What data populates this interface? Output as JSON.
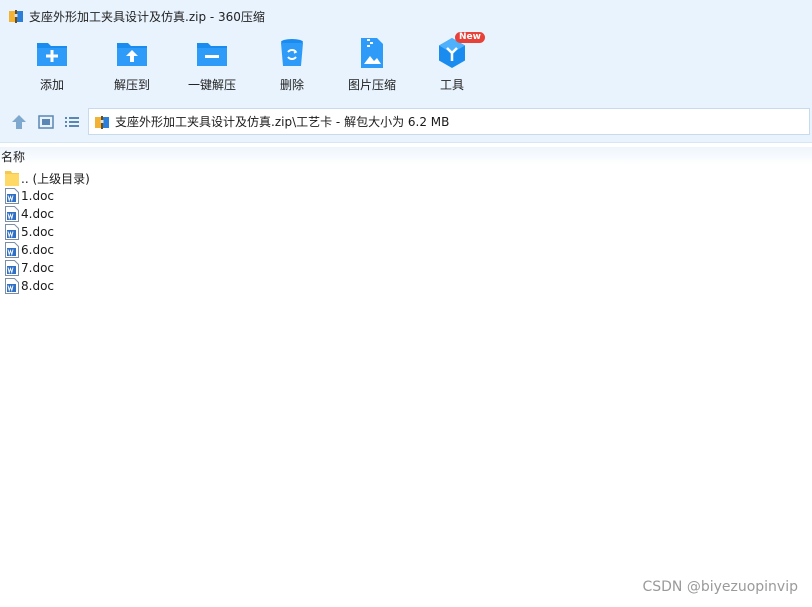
{
  "window": {
    "title": "支座外形加工夹具设计及仿真.zip - 360压缩"
  },
  "toolbar": {
    "items": [
      {
        "label": "添加",
        "icon": "add-folder-icon"
      },
      {
        "label": "解压到",
        "icon": "extract-to-icon"
      },
      {
        "label": "一键解压",
        "icon": "one-click-extract-icon"
      },
      {
        "label": "删除",
        "icon": "trash-icon"
      },
      {
        "label": "图片压缩",
        "icon": "image-compress-icon"
      },
      {
        "label": "工具",
        "icon": "tools-icon",
        "badge": "New"
      }
    ]
  },
  "address": {
    "path": "支座外形加工夹具设计及仿真.zip\\工艺卡 - 解包大小为 6.2 MB"
  },
  "list": {
    "column_name": "名称",
    "items": [
      {
        "name": ".. (上级目录)",
        "icon": "folder-icon"
      },
      {
        "name": "1.doc",
        "icon": "word-doc-icon"
      },
      {
        "name": "4.doc",
        "icon": "word-doc-icon"
      },
      {
        "name": "5.doc",
        "icon": "word-doc-icon"
      },
      {
        "name": "6.doc",
        "icon": "word-doc-icon"
      },
      {
        "name": "7.doc",
        "icon": "word-doc-icon"
      },
      {
        "name": "8.doc",
        "icon": "word-doc-icon"
      }
    ]
  },
  "watermark": "CSDN @biyezuopinvip",
  "colors": {
    "accent": "#1a8cf0",
    "toolbar_bg": "#e9f3fd",
    "badge": "#e8413a"
  }
}
